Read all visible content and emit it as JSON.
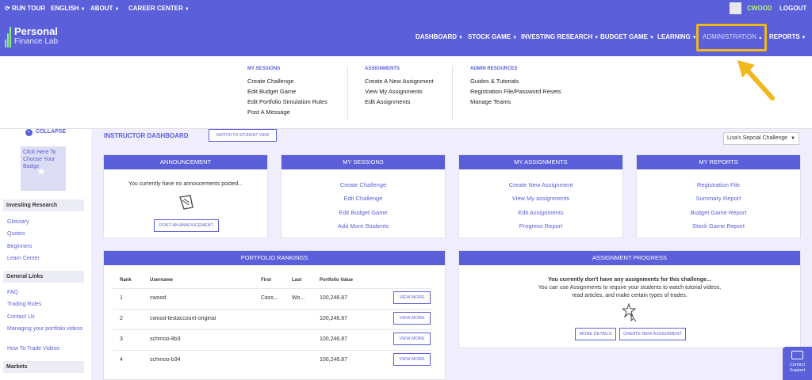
{
  "topbar": {
    "run_tour": "RUN TOUR",
    "language": "ENGLISH",
    "about": "ABOUT",
    "career_center": "CAREER CENTER",
    "username": "CWOOD",
    "logout": "LOGOUT"
  },
  "logo": {
    "line1": "Personal",
    "line2": "Finance Lab"
  },
  "nav": {
    "dashboard": "DASHBOARD",
    "stock_game": "STOCK GAME",
    "investing_research": "INVESTING RESEARCH",
    "budget_game": "BUDGET GAME",
    "learning": "LEARNING",
    "administration": "ADMINISTRATION",
    "reports": "REPORTS"
  },
  "dropdown": {
    "sessions": {
      "head": "MY SESSIONS",
      "items": [
        "Create Challenge",
        "Edit Budget Game",
        "Edit Portfolio Simulation Rules",
        "Post A Message"
      ]
    },
    "assignments": {
      "head": "ASSIGNMENTS",
      "items": [
        "Create A New Assignment",
        "View My Assignments",
        "Edit Assignments"
      ]
    },
    "admin": {
      "head": "ADMIN RESOURCES",
      "items": [
        "Guides & Tutorials",
        "Registration File/Password Resets",
        "Manage Teams"
      ]
    }
  },
  "sidebar": {
    "collapse": "COLLAPSE",
    "badge_text": "Click Here To Choose Your Badge",
    "investing_head": "Investing Research",
    "investing_links": [
      "Glossary",
      "Quotes",
      "Beginners",
      "Learn Center"
    ],
    "general_head": "General Links",
    "general_links": [
      "FAQ",
      "Trading Rules",
      "Contact Us",
      "Managing your portfolio videos",
      "How To Trade Videos"
    ],
    "markets_head": "Markets"
  },
  "dashboard": {
    "title": "INSTRUCTOR DASHBOARD",
    "switch_label": "SWITCH TO STUDENT VIEW",
    "challenge_selected": "Lisa's Sepcial Challenge"
  },
  "announcement": {
    "title": "ANNOUNCEMENT",
    "empty_text": "You currently have no annoucements posted...",
    "post_button": "POST AN ANNOUCEMENT"
  },
  "my_sessions": {
    "title": "MY SESSIONS",
    "links": [
      "Create Challenge",
      "Edit Challenge",
      "Edit Budget Game",
      "Add More Students"
    ]
  },
  "my_assignments": {
    "title": "MY ASSIGNMENTS",
    "links": [
      "Create New Assignment",
      "View My assignments",
      "Edit Assignments",
      "Progress Report"
    ]
  },
  "my_reports": {
    "title": "MY REPORTS",
    "links": [
      "Registration File",
      "Summary Report",
      "Budget Game Report",
      "Stock Game Report"
    ]
  },
  "portfolio": {
    "title": "PORTFOLIO RANKINGS",
    "columns": [
      "Rank",
      "Username",
      "First",
      "Last",
      "Portfolio Value"
    ],
    "rows": [
      {
        "rank": "1",
        "username": "cwood",
        "first": "Cass...",
        "last": "Wo...",
        "value": "100,246.87"
      },
      {
        "rank": "2",
        "username": "cwood-testaccount-original",
        "first": "",
        "last": "",
        "value": "100,246.87"
      },
      {
        "rank": "3",
        "username": "schmoo-8b3",
        "first": "",
        "last": "",
        "value": "100,246.87"
      },
      {
        "rank": "4",
        "username": "schmoo-b34",
        "first": "",
        "last": "",
        "value": "100,246.87"
      }
    ],
    "view_more": "VIEW MORE"
  },
  "assignment_progress": {
    "title": "ASSIGNMENT PROGRESS",
    "headline": "You currently don't have any assignments for this challenge...",
    "body1": "You can use Assignments to require your students to watch tutorial videos,",
    "body2": "read articles, and make certain types of trades.",
    "more_details": "MORE DETAILS",
    "create_new": "CREATE NEW ASSIGNMENT"
  },
  "contact": {
    "line1": "Contact",
    "line2": "Support"
  },
  "colors": {
    "brand": "#5b5fd9",
    "highlight": "#f2b71c",
    "username": "#b6f36b"
  }
}
